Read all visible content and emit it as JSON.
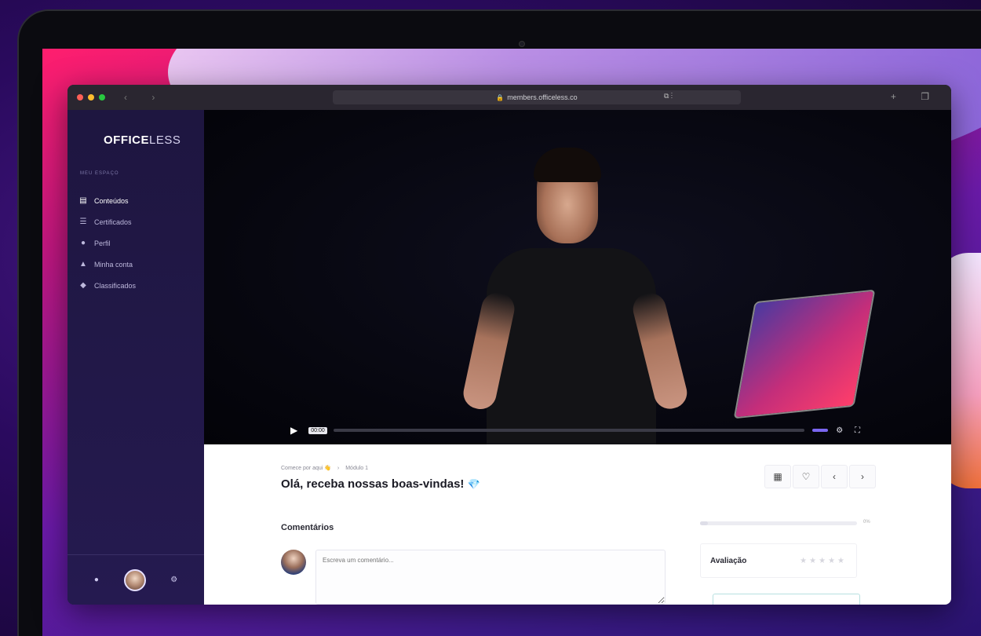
{
  "browser": {
    "url": "members.officeless.co",
    "nav_arrows": "‹ ›",
    "mid_icons": "⧉ ⋮",
    "right_icons": "+ ❐"
  },
  "sidebar": {
    "logo_bold": "OFFICE",
    "logo_light": "LESS",
    "section_label": "MEU ESPAÇO",
    "items": [
      {
        "icon": "▤",
        "label": "Conteúdos"
      },
      {
        "icon": "☰",
        "label": "Certificados"
      },
      {
        "icon": "●",
        "label": "Perfil"
      },
      {
        "icon": "▲",
        "label": "Minha conta"
      },
      {
        "icon": "◆",
        "label": "Classificados"
      }
    ],
    "bottom": {
      "left_icon": "●",
      "right_icon": "⚙"
    }
  },
  "video": {
    "timecode": "00:00",
    "progress": 0.0,
    "controls_right": "⚙ ⛶"
  },
  "lesson": {
    "breadcrumb_course": "Comece por aqui 👋",
    "breadcrumb_sep": "›",
    "breadcrumb_module": "Módulo 1",
    "title": "Olá, receba nossas boas-vindas!",
    "gem": "💎",
    "tools": [
      "▦",
      "♡",
      "‹",
      "›"
    ]
  },
  "comments": {
    "label": "Comentários",
    "placeholder": "Escreva um comentário..."
  },
  "rating": {
    "label": "Avaliação",
    "stars": "★★★★★",
    "progress_pct": "0%",
    "progress": 0.05
  }
}
